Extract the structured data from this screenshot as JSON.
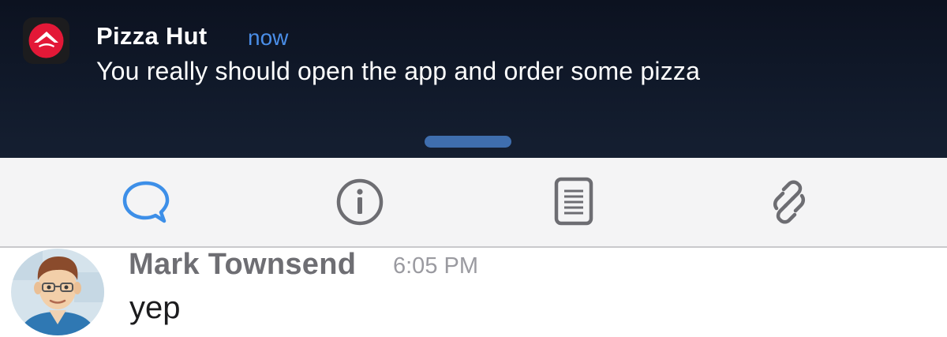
{
  "notification": {
    "app_name": "Pizza Hut",
    "time": "now",
    "body": "You really should open the app and order some pizza",
    "icon": "pizza-hut-logo-icon"
  },
  "toolbar": {
    "tabs": [
      {
        "id": "chat",
        "icon": "chat-bubble-icon",
        "active": true
      },
      {
        "id": "info",
        "icon": "info-icon",
        "active": false
      },
      {
        "id": "document",
        "icon": "document-icon",
        "active": false
      },
      {
        "id": "link",
        "icon": "link-icon",
        "active": false
      }
    ]
  },
  "message": {
    "sender": "Mark Townsend",
    "time": "6:05 PM",
    "text": "yep"
  },
  "colors": {
    "accent": "#3d8fe8",
    "notification_bg": "#0f1626",
    "icon_gray": "#6d6d72",
    "brand_red": "#e31837"
  }
}
